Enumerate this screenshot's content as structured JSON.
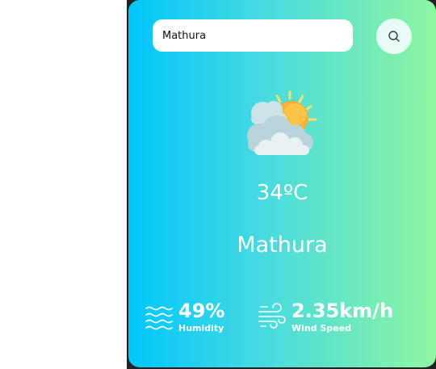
{
  "search": {
    "value": "Mathura"
  },
  "weather": {
    "icon": "partly-cloudy-icon",
    "temperature": "34ºC",
    "city": "Mathura"
  },
  "details": {
    "humidity_value": "49%",
    "humidity_label": "Humidity",
    "humidity_icon": "humidity-waves-icon",
    "wind_value": "2.35km/h",
    "wind_label": "Wind Speed",
    "wind_icon": "wind-icon"
  },
  "colors": {
    "gradient_start": "#00c6fb",
    "gradient_end": "#8ef6a0",
    "card_text": "#ffffff"
  }
}
